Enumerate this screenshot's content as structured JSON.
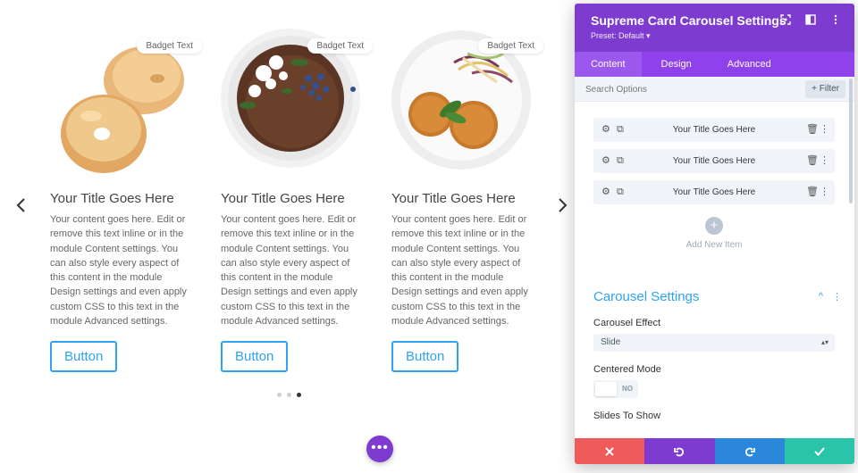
{
  "carousel": {
    "cards": [
      {
        "badge": "Badget Text",
        "title": "Your Title Goes Here",
        "text": "Your content goes here. Edit or remove this text inline or in the module Content settings. You can also style every aspect of this content in the module Design settings and even apply custom CSS to this text in the module Advanced settings.",
        "button": "Button",
        "image": "bagels"
      },
      {
        "badge": "Badget Text",
        "title": "Your Title Goes Here",
        "text": "Your content goes here. Edit or remove this text inline or in the module Content settings. You can also style every aspect of this content in the module Design settings and even apply custom CSS to this text in the module Advanced settings.",
        "button": "Button",
        "image": "chocolate-cake-plate"
      },
      {
        "badge": "Badget Text",
        "title": "Your Title Goes Here",
        "text": "Your content goes here. Edit or remove this text inline or in the module Content settings. You can also style every aspect of this content in the module Design settings and even apply custom CSS to this text in the module Advanced settings.",
        "button": "Button",
        "image": "patties-salad-plate"
      }
    ],
    "prev_icon": "chevron-left-icon",
    "next_icon": "chevron-right-icon",
    "dots_count": 3,
    "active_dot": 3
  },
  "fab": {
    "label": "•••",
    "icon": "more-horizontal-icon"
  },
  "panel": {
    "title": "Supreme Card Carousel Settings",
    "preset": "Preset: Default ▾",
    "tabs": [
      {
        "label": "Content",
        "active": true
      },
      {
        "label": "Design",
        "active": false
      },
      {
        "label": "Advanced",
        "active": false
      }
    ],
    "search_placeholder": "Search Options",
    "filter_label": "+ Filter",
    "items": [
      {
        "label": "Your Title Goes Here"
      },
      {
        "label": "Your Title Goes Here"
      },
      {
        "label": "Your Title Goes Here"
      }
    ],
    "add_label": "Add New Item",
    "section_title": "Carousel Settings",
    "carousel_effect_label": "Carousel Effect",
    "carousel_effect_value": "Slide",
    "centered_mode_label": "Centered Mode",
    "centered_mode_value": "NO",
    "slides_to_show_label": "Slides To Show"
  },
  "colors": {
    "panel_header": "#7e3bd0",
    "tabs_bar": "#8f42ec",
    "accent_blue": "#2ea3f2",
    "cancel": "#ef5a5a",
    "undo": "#7e3bd0",
    "redo": "#2b87da",
    "save": "#29c4a9"
  }
}
